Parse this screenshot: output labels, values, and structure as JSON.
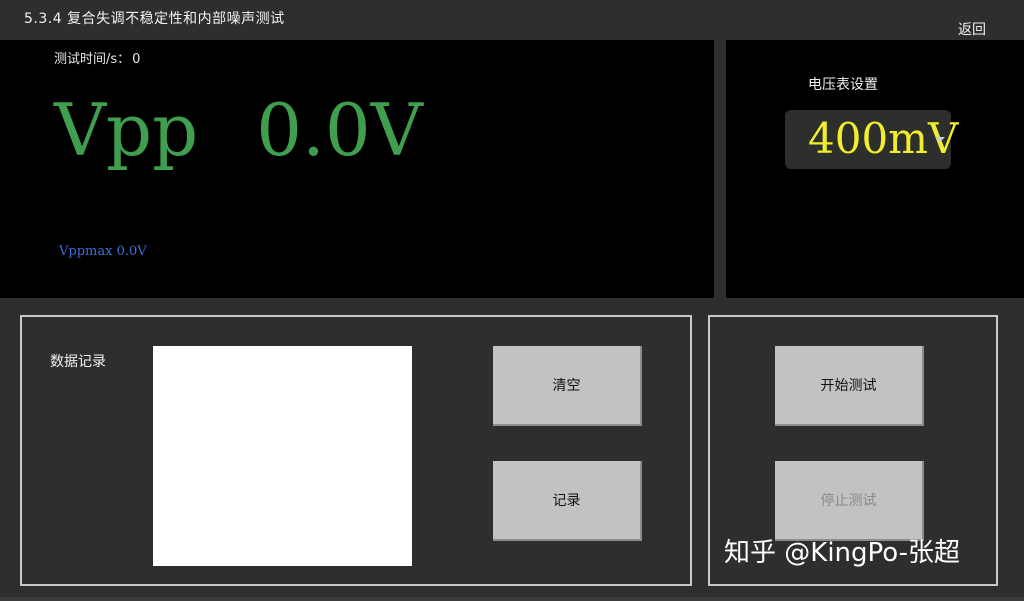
{
  "header": {
    "title": "5.3.4 复合失调不稳定性和内部噪声测试",
    "back_label": "返回"
  },
  "measurement": {
    "test_time_label": "测试时间/s：",
    "test_time_value": "0",
    "vpp_label": "Vpp",
    "vpp_value": "0.0V",
    "vppmax_text": "Vppmax 0.0V"
  },
  "voltmeter": {
    "label": "电压表设置",
    "range_value": "400mV"
  },
  "record": {
    "label": "数据记录",
    "clear_label": "清空",
    "record_label": "记录"
  },
  "test": {
    "start_label": "开始测试",
    "stop_label": "停止测试"
  },
  "watermark": {
    "text": "知乎 @KingPo-张超"
  },
  "colors": {
    "background": "#2d2f2c",
    "panel": "#000000",
    "vpp_green": "#3f9f4f",
    "vppmax_blue": "#3b6fd6",
    "range_yellow": "#f3ee2c",
    "button_gray": "#c3c1c4"
  },
  "icons": {
    "range_caret": "chevron-down-icon"
  }
}
